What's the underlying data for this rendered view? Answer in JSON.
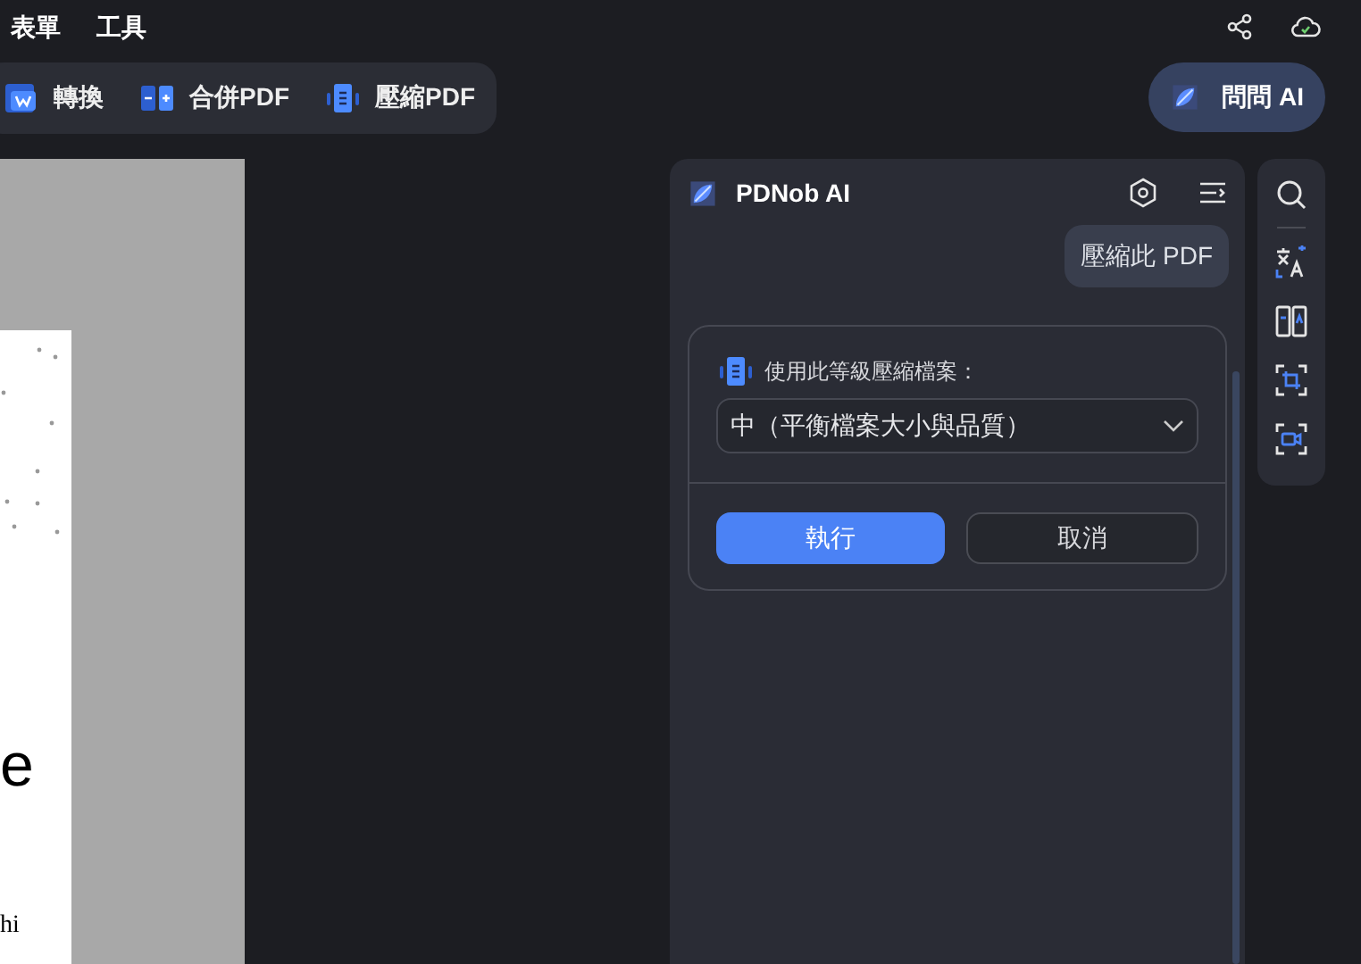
{
  "menu": [
    {
      "label": "表單"
    },
    {
      "label": "工具"
    }
  ],
  "toolbar": [
    {
      "label": "轉換",
      "kind": "convert"
    },
    {
      "label": "合併PDF",
      "kind": "merge"
    },
    {
      "label": "壓縮PDF",
      "kind": "compress"
    }
  ],
  "ask_ai": {
    "label": "問問 AI"
  },
  "document": {
    "large_text": "e",
    "small_text": "hi"
  },
  "ai_panel": {
    "title": "PDNob AI",
    "user_message": "壓縮此 PDF",
    "compress_card": {
      "label": "使用此等級壓縮檔案：",
      "select_value": "中（平衡檔案大小與品質）",
      "buttons": [
        {
          "label": "執行",
          "kind": "primary"
        },
        {
          "label": "取消",
          "kind": "secondary"
        }
      ]
    }
  }
}
